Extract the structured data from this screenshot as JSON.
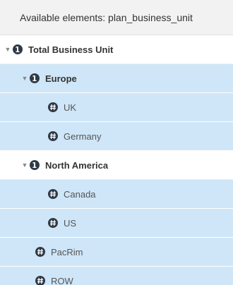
{
  "header": {
    "title": "Available elements: plan_business_unit"
  },
  "tree": [
    {
      "id": "total-business-unit",
      "label": "Total Business Unit",
      "type": "consolidated",
      "expanded": true,
      "highlighted": false
    },
    {
      "id": "europe",
      "label": "Europe",
      "type": "consolidated",
      "expanded": true,
      "highlighted": true
    },
    {
      "id": "uk",
      "label": "UK",
      "type": "leaf",
      "highlighted": true
    },
    {
      "id": "germany",
      "label": "Germany",
      "type": "leaf",
      "highlighted": true
    },
    {
      "id": "north-america",
      "label": "North America",
      "type": "consolidated",
      "expanded": true,
      "highlighted": false
    },
    {
      "id": "canada",
      "label": "Canada",
      "type": "leaf",
      "highlighted": true
    },
    {
      "id": "us",
      "label": "US",
      "type": "leaf",
      "highlighted": true
    },
    {
      "id": "pacrim",
      "label": "PacRim",
      "type": "leaf",
      "highlighted": true
    },
    {
      "id": "row",
      "label": "ROW",
      "type": "leaf",
      "highlighted": true
    }
  ],
  "icons": {
    "consolidated": "consolidated-element-icon",
    "leaf": "leaf-element-icon",
    "expand": "chevron-down-icon"
  },
  "colors": {
    "highlight": "#cfe6f8",
    "icon": "#2f3a46",
    "header_bg": "#f2f2f2"
  }
}
